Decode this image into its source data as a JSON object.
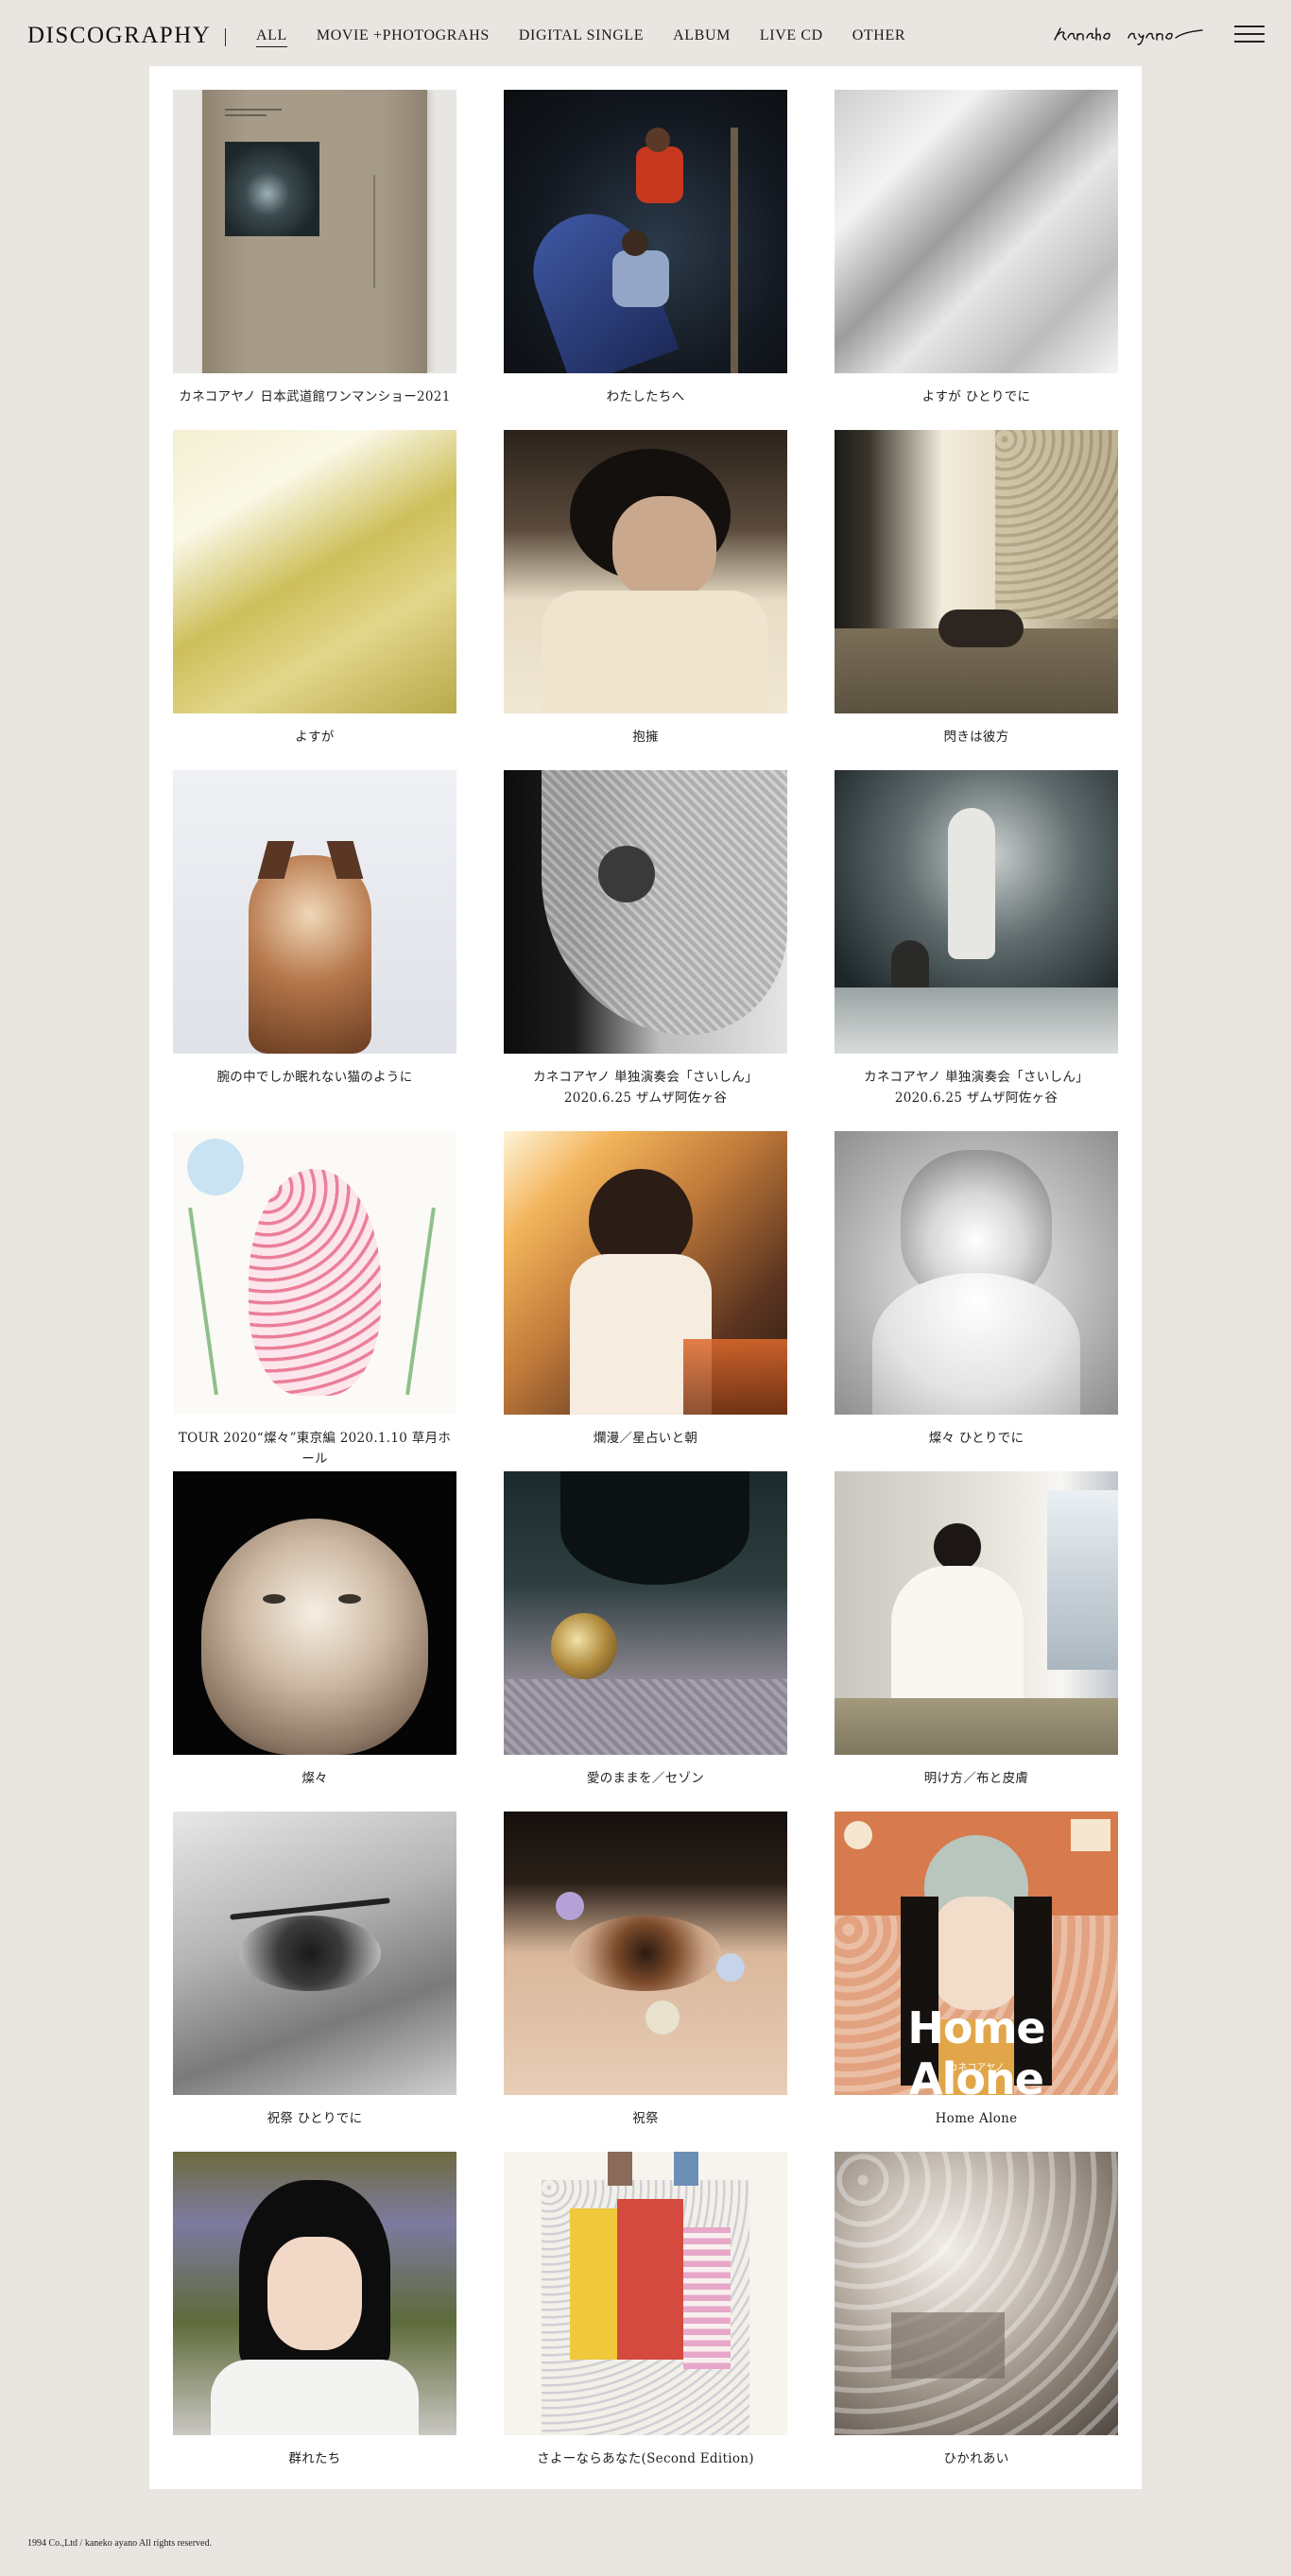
{
  "header": {
    "title": "DISCOGRAPHY",
    "signature": "kaneko ayano",
    "nav": [
      {
        "label": "ALL",
        "active": true
      },
      {
        "label": "MOVIE +PHOTOGRAHS"
      },
      {
        "label": "DIGITAL SINGLE"
      },
      {
        "label": "ALBUM"
      },
      {
        "label": "LIVE CD"
      },
      {
        "label": "OTHER"
      }
    ]
  },
  "items": [
    {
      "title": "カネコアヤノ 日本武道館ワンマンショー2021",
      "art": "book-cover"
    },
    {
      "title": "わたしたちへ",
      "art": "night-slide-photo"
    },
    {
      "title": "よすが ひとりでに",
      "art": "grey-fabric"
    },
    {
      "title": "よすが",
      "art": "yellow-fabric"
    },
    {
      "title": "抱擁",
      "art": "portrait-lying"
    },
    {
      "title": "閃きは彼方",
      "art": "room-window-light"
    },
    {
      "title": "腕の中でしか眠れない猫のように",
      "art": "cat-jump"
    },
    {
      "title": "カネコアヤノ 単独演奏会「さいしん」2020.6.25 ザムザ阿佐ヶ谷",
      "art": "lace-curtain-bw"
    },
    {
      "title": "カネコアヤノ 単独演奏会「さいしん」2020.6.25 ザムザ阿佐ヶ谷",
      "art": "guitar-stage-bw"
    },
    {
      "title": "TOUR 2020“燦々”東京編 2020.1.10 草月ホール",
      "art": "flower-illustration"
    },
    {
      "title": "爛漫／星占いと朝",
      "art": "sunlit-rooftop"
    },
    {
      "title": "燦々 ひとりでに",
      "art": "grey-cat"
    },
    {
      "title": "燦々",
      "art": "persian-cat"
    },
    {
      "title": "愛のままを／セゾン",
      "art": "glitter-face"
    },
    {
      "title": "明け方／布と皮膚",
      "art": "white-dress-tatami"
    },
    {
      "title": "祝祭 ひとりでに",
      "art": "eye-bw"
    },
    {
      "title": "祝祭",
      "art": "eye-flowers"
    },
    {
      "title": "Home Alone",
      "art": "home-alone-cover",
      "cover_text": "Home Alone",
      "cover_sub": "カネコアヤノ"
    },
    {
      "title": "群れたち",
      "art": "portrait-garden"
    },
    {
      "title": "さよーならあなた(Second Edition)",
      "art": "pattern-dress-illustration"
    },
    {
      "title": "ひかれあい",
      "art": "blossom-window"
    }
  ],
  "footer": {
    "copyright": "1994 Co.,Ltd / kaneko ayano All rights reserved."
  }
}
